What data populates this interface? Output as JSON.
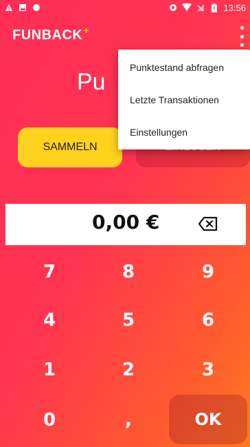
{
  "status_bar": {
    "time": "13:56",
    "left_icons": [
      "alert-icon",
      "image-icon",
      "circle-icon"
    ],
    "right_icons": [
      "sync-icon",
      "wifi-icon",
      "signal-icon",
      "battery-icon"
    ]
  },
  "app_bar": {
    "logo_text": "FUNBACK",
    "logo_plus": "+",
    "overflow_icon": "more-vert-icon"
  },
  "main": {
    "title_partial": "Pu",
    "modes": {
      "sammeln": "SAMMELN",
      "einlosen": "EINLÖSEN"
    },
    "amount": "0,00 €",
    "backspace_icon": "backspace-icon"
  },
  "keypad": {
    "keys": [
      "7",
      "8",
      "9",
      "4",
      "5",
      "6",
      "1",
      "2",
      "3",
      "0",
      ","
    ],
    "ok_label": "OK"
  },
  "menu": {
    "items": [
      "Punktestand abfragen",
      "Letzte Transaktionen",
      "Einstellungen"
    ]
  },
  "colors": {
    "accent_yellow": "#ffd21e",
    "gradient_start": "#ff2d55",
    "gradient_end": "#ff7a1f"
  }
}
